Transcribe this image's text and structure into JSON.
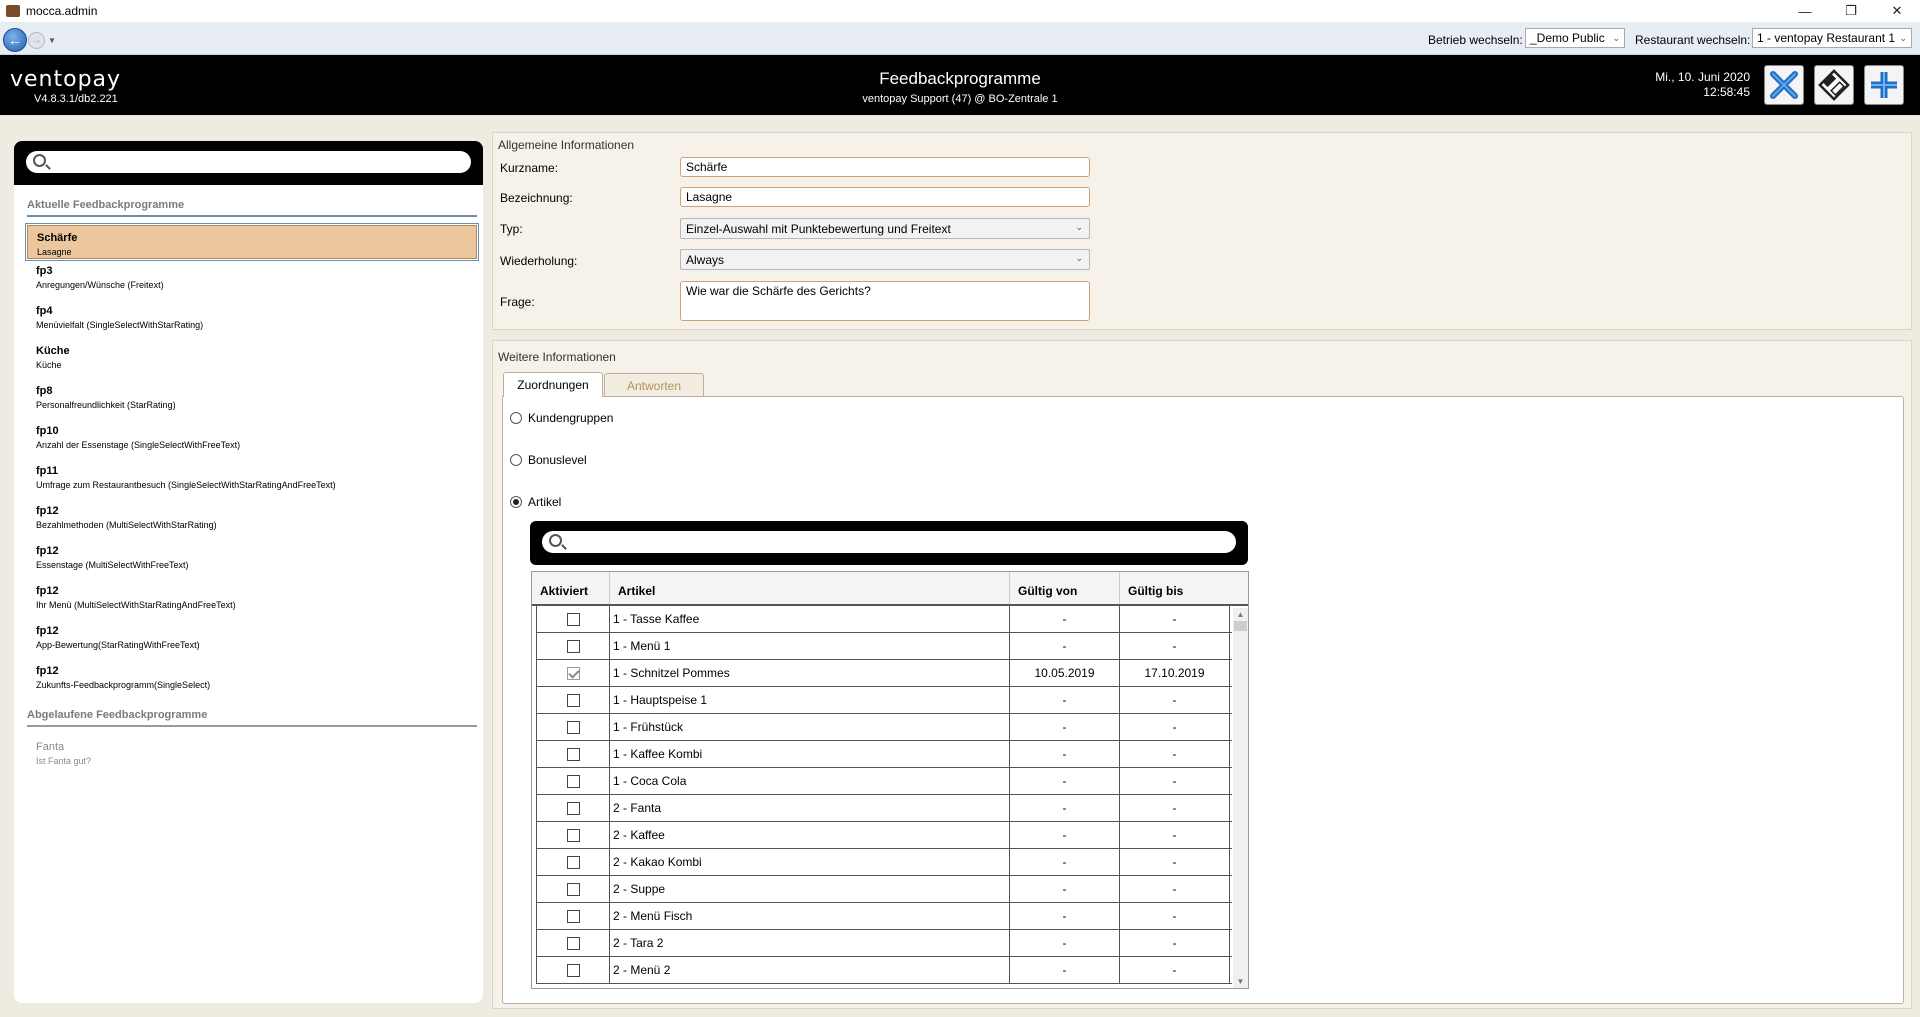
{
  "window": {
    "title": "mocca.admin",
    "minimize": "—",
    "restore": "❐",
    "close": "✕"
  },
  "navbar": {
    "betrieb_label": "Betrieb wechseln:",
    "betrieb_value": "_Demo Public",
    "restaurant_label": "Restaurant wechseln:",
    "restaurant_value": "1 - ventopay Restaurant 1"
  },
  "header": {
    "logo": "ventopay",
    "version": "V4.8.3.1/db2.221",
    "title": "Feedbackprogramme",
    "subtitle": "ventopay Support (47) @ BO-Zentrale 1",
    "date": "Mi., 10. Juni 2020",
    "time": "12:58:45"
  },
  "left": {
    "search_placeholder": "",
    "current_heading": "Aktuelle Feedbackprogramme",
    "current": [
      {
        "name": "Schärfe",
        "desc": "Lasagne"
      },
      {
        "name": "fp3",
        "desc": "Anregungen/Wünsche (Freitext)"
      },
      {
        "name": "fp4",
        "desc": "Menüvielfalt (SingleSelectWithStarRating)"
      },
      {
        "name": "Küche",
        "desc": "Küche"
      },
      {
        "name": "fp8",
        "desc": "Personalfreundlichkeit (StarRating)"
      },
      {
        "name": "fp10",
        "desc": "Anzahl der Essenstage (SingleSelectWithFreeText)"
      },
      {
        "name": "fp11",
        "desc": "Umfrage zum Restaurantbesuch (SingleSelectWithStarRatingAndFreeText)"
      },
      {
        "name": "fp12",
        "desc": "Bezahlmethoden (MultiSelectWithStarRating)"
      },
      {
        "name": "fp12",
        "desc": "Essenstage (MultiSelectWithFreeText)"
      },
      {
        "name": "fp12",
        "desc": "Ihr Menü (MultiSelectWithStarRatingAndFreeText)"
      },
      {
        "name": "fp12",
        "desc": "App-Bewertung(StarRatingWithFreeText)"
      },
      {
        "name": "fp12",
        "desc": "Zukunfts-Feedbackprogramm(SingleSelect)"
      }
    ],
    "expired_heading": "Abgelaufene Feedbackprogramme",
    "expired": [
      {
        "name": "Fanta",
        "desc": "Ist Fanta gut?"
      }
    ]
  },
  "general": {
    "title": "Allgemeine Informationen",
    "kurzname_label": "Kurzname:",
    "kurzname_value": "Schärfe",
    "bezeichnung_label": "Bezeichnung:",
    "bezeichnung_value": "Lasagne",
    "typ_label": "Typ:",
    "typ_value": "Einzel-Auswahl mit Punktebewertung und Freitext",
    "wiederholung_label": "Wiederholung:",
    "wiederholung_value": "Always",
    "frage_label": "Frage:",
    "frage_value": "Wie war die Schärfe des Gerichts?"
  },
  "further": {
    "title": "Weitere Informationen",
    "tabs": [
      {
        "label": "Zuordnungen"
      },
      {
        "label": "Antworten"
      }
    ],
    "radios": [
      {
        "label": "Kundengruppen",
        "checked": false
      },
      {
        "label": "Bonuslevel",
        "checked": false
      },
      {
        "label": "Artikel",
        "checked": true
      }
    ],
    "grid": {
      "headers": [
        "Aktiviert",
        "Artikel",
        "Gültig von",
        "Gültig bis"
      ],
      "rows": [
        {
          "checked": false,
          "article": "1 - Tasse Kaffee",
          "from": "-",
          "to": "-"
        },
        {
          "checked": false,
          "article": "1 - Menü 1",
          "from": "-",
          "to": "-"
        },
        {
          "checked": true,
          "article": "1 - Schnitzel Pommes",
          "from": "10.05.2019",
          "to": "17.10.2019"
        },
        {
          "checked": false,
          "article": "1 - Hauptspeise 1",
          "from": "-",
          "to": "-"
        },
        {
          "checked": false,
          "article": "1 - Frühstück",
          "from": "-",
          "to": "-"
        },
        {
          "checked": false,
          "article": "1 - Kaffee Kombi",
          "from": "-",
          "to": "-"
        },
        {
          "checked": false,
          "article": "1 - Coca Cola",
          "from": "-",
          "to": "-"
        },
        {
          "checked": false,
          "article": "2 - Fanta",
          "from": "-",
          "to": "-"
        },
        {
          "checked": false,
          "article": "2 - Kaffee",
          "from": "-",
          "to": "-"
        },
        {
          "checked": false,
          "article": "2 - Kakao Kombi",
          "from": "-",
          "to": "-"
        },
        {
          "checked": false,
          "article": "2 - Suppe",
          "from": "-",
          "to": "-"
        },
        {
          "checked": false,
          "article": "2 - Menü Fisch",
          "from": "-",
          "to": "-"
        },
        {
          "checked": false,
          "article": "2 - Tara 2",
          "from": "-",
          "to": "-"
        },
        {
          "checked": false,
          "article": "2 - Menü 2",
          "from": "-",
          "to": "-"
        }
      ]
    }
  }
}
